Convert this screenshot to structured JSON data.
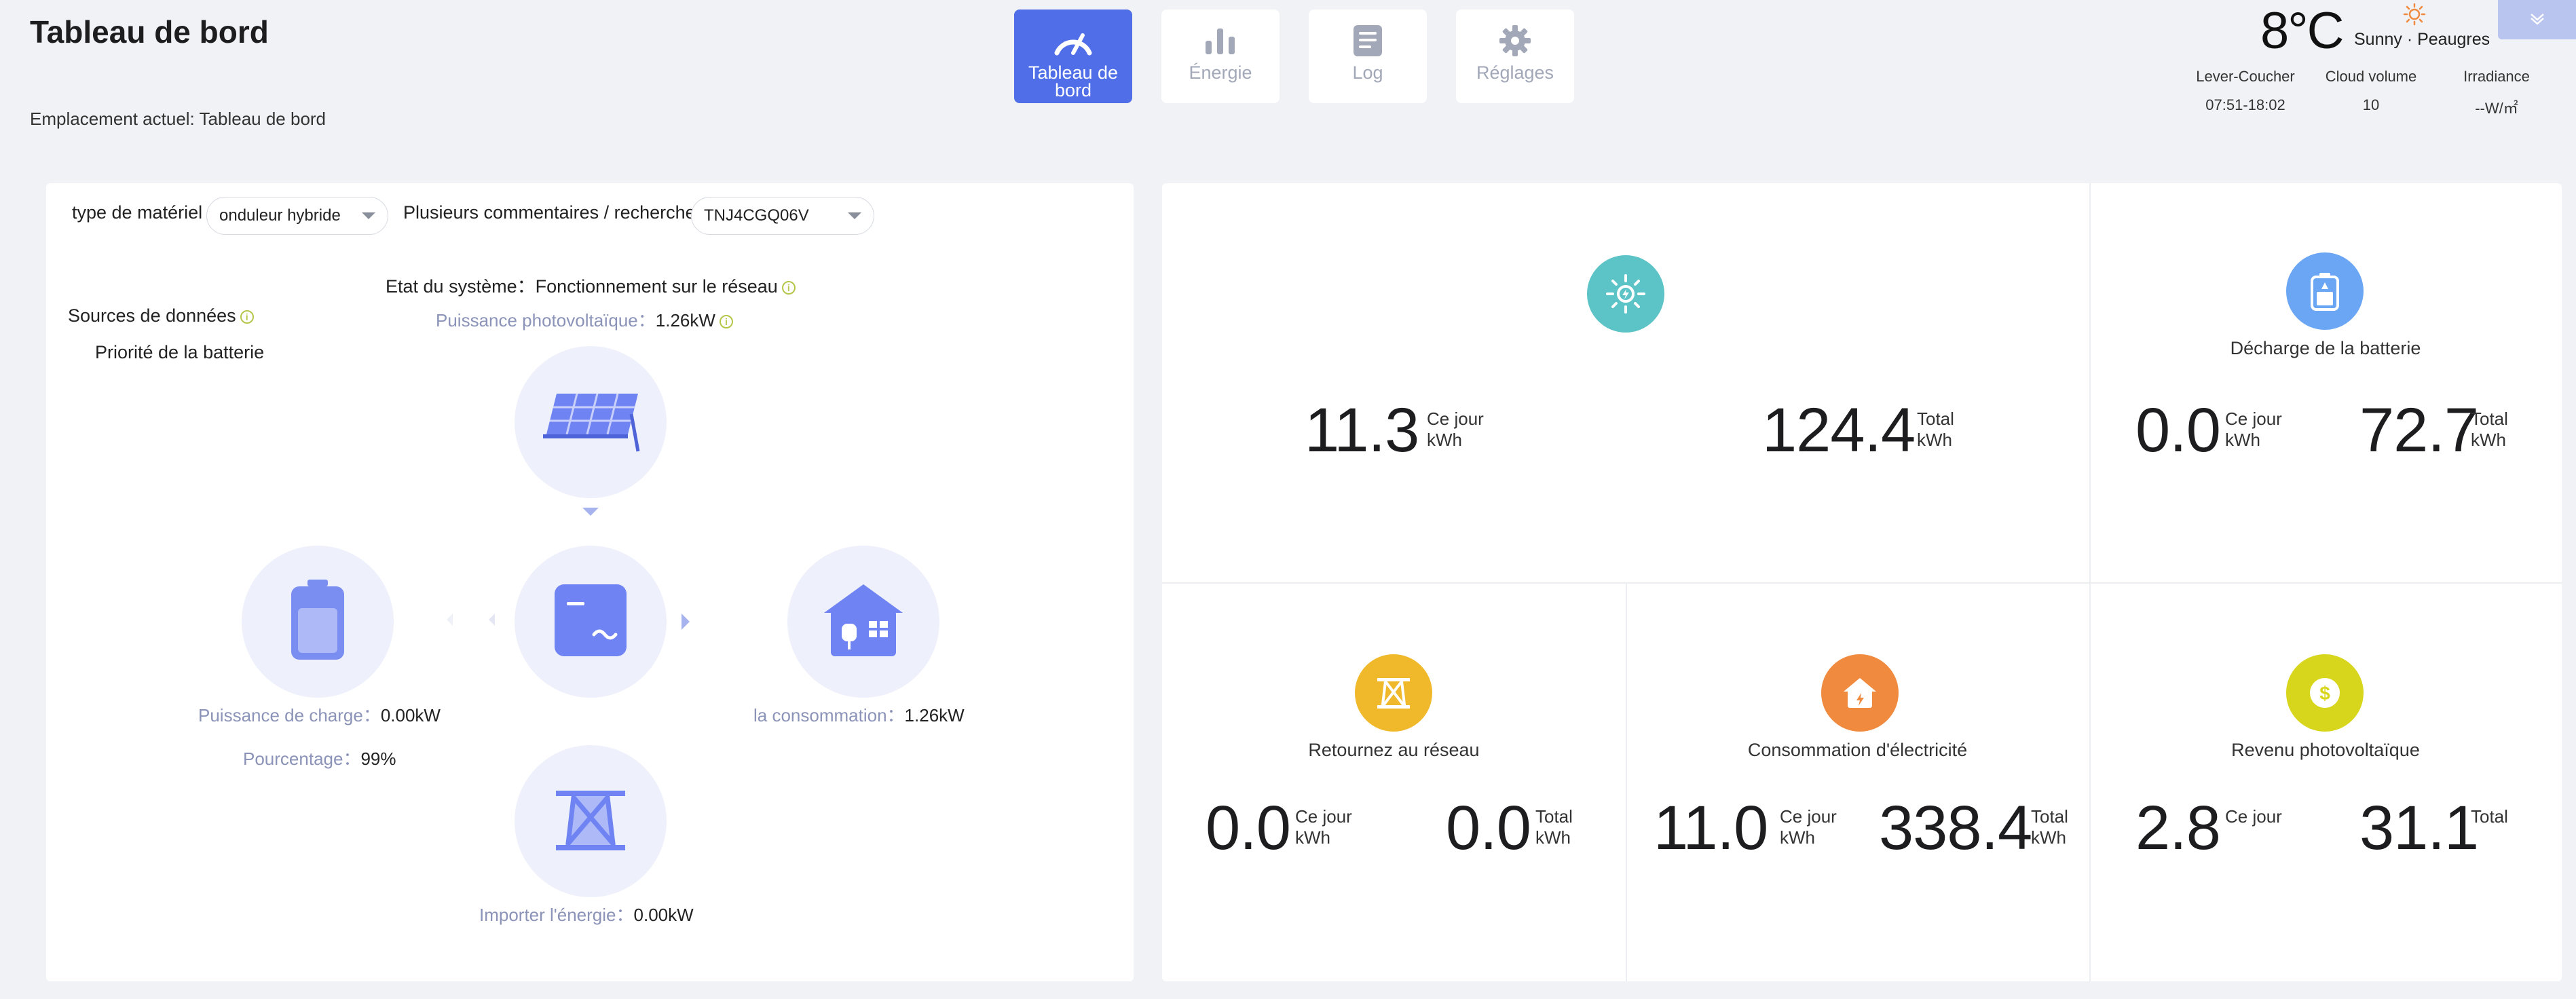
{
  "header": {
    "title": "Tableau de bord",
    "breadcrumb": "Emplacement actuel: Tableau de bord"
  },
  "nav": [
    {
      "label": "Tableau de bord",
      "icon": "gauge-icon",
      "active": true
    },
    {
      "label": "Énergie",
      "icon": "bar-chart-icon",
      "active": false
    },
    {
      "label": "Log",
      "icon": "list-icon",
      "active": false
    },
    {
      "label": "Réglages",
      "icon": "gear-icon",
      "active": false
    }
  ],
  "weather": {
    "temp": "8°C",
    "desc": "Sunny · Peaugres",
    "sunrise_label": "Lever-Coucher",
    "sunrise_value": "07:51-18:02",
    "cloud_label": "Cloud volume",
    "cloud_value": "10",
    "irradiance_label": "Irradiance",
    "irradiance_value": "--W/㎡"
  },
  "flow": {
    "device_type_label": "type de matériel",
    "device_type_value": "onduleur hybride",
    "search_label": "Plusieurs commentaires / recherche",
    "search_value": "TNJ4CGQ06V",
    "data_sources_label": "Sources de données",
    "battery_priority": "Priorité de la batterie",
    "system_state_label": "Etat du système：",
    "system_state_value": "Fonctionnement sur le réseau",
    "pv_power_label": "Puissance photovoltaïque：",
    "pv_power_value": "1.26kW",
    "charge_power_label": "Puissance de charge：",
    "charge_power_value": "0.00kW",
    "percentage_label": "Pourcentage：",
    "percentage_value": "99%",
    "consumption_label": "la consommation：",
    "consumption_value": "1.26kW",
    "import_label": "Importer l'énergie：",
    "import_value": "0.00kW"
  },
  "stats": {
    "pv": {
      "today": "11.3",
      "today_label": "Ce jour",
      "today_unit": "kWh",
      "total": "124.4",
      "total_label": "Total",
      "total_unit": "kWh"
    },
    "battery": {
      "title": "Décharge de la batterie",
      "today": "0.0",
      "today_label": "Ce jour",
      "today_unit": "kWh",
      "total": "72.7",
      "total_label": "Total",
      "total_unit": "kWh"
    },
    "grid": {
      "title": "Retournez au réseau",
      "today": "0.0",
      "today_label": "Ce jour",
      "today_unit": "kWh",
      "total": "0.0",
      "total_label": "Total",
      "total_unit": "kWh"
    },
    "consumption": {
      "title": "Consommation d'électricité",
      "today": "11.0",
      "today_label": "Ce jour",
      "today_unit": "kWh",
      "total": "338.4",
      "total_label": "Total",
      "total_unit": "kWh"
    },
    "revenue": {
      "title": "Revenu photovoltaïque",
      "today": "2.8",
      "today_label": "Ce jour",
      "total": "31.1",
      "total_label": "Total"
    }
  },
  "colors": {
    "accent": "#4f6ee8",
    "pv": "#5cc3c6",
    "battery": "#6aa6f3",
    "grid": "#f0b92c",
    "consumption": "#f08a3f",
    "revenue": "#d8d61c"
  }
}
